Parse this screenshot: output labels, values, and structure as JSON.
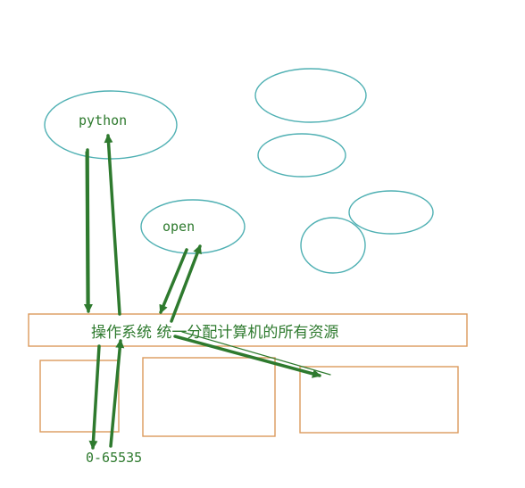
{
  "labels": {
    "python": "python",
    "open": "open",
    "os_bar": "操作系统 统一分配计算机的所有资源",
    "port_range": "0-65535"
  },
  "colors": {
    "ellipse_stroke": "#4fb0b3",
    "box_stroke": "#dc9a5c",
    "arrow": "#2e7a2e",
    "text": "#2e7a2e"
  }
}
